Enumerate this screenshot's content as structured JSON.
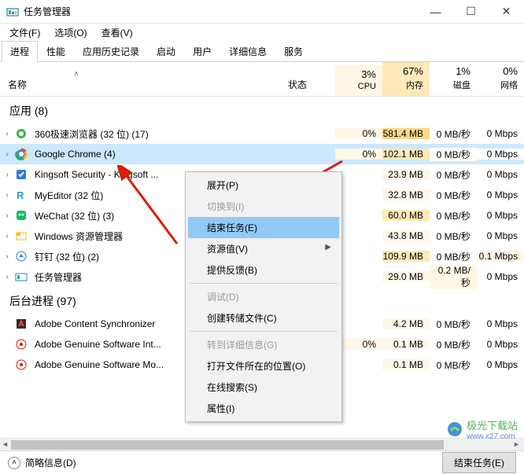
{
  "window": {
    "title": "任务管理器"
  },
  "window_controls": {
    "min": "—",
    "max": "☐",
    "close": "✕"
  },
  "menu": {
    "file": "文件(F)",
    "options": "选项(O)",
    "view": "查看(V)"
  },
  "tabs": [
    "进程",
    "性能",
    "应用历史记录",
    "启动",
    "用户",
    "详细信息",
    "服务"
  ],
  "columns": {
    "name": "名称",
    "status": "状态",
    "cpu": {
      "pct": "3%",
      "label": "CPU"
    },
    "mem": {
      "pct": "67%",
      "label": "内存"
    },
    "disk": {
      "pct": "1%",
      "label": "磁盘"
    },
    "net": {
      "pct": "0%",
      "label": "网络"
    }
  },
  "sort_indicator": "˄",
  "groups": {
    "apps": "应用 (8)",
    "background": "后台进程 (97)"
  },
  "rows": [
    {
      "name": "360极速浏览器 (32 位) (17)",
      "cpu": "0%",
      "mem": "581.4 MB",
      "disk": "0 MB/秒",
      "net": "0 Mbps",
      "memClass": "hot1"
    },
    {
      "name": "Google Chrome (4)",
      "cpu": "0%",
      "mem": "102.1 MB",
      "disk": "0 MB/秒",
      "net": "0 Mbps",
      "selected": true,
      "memClass": "hot2"
    },
    {
      "name": "Kingsoft Security - Kingsoft ...",
      "cpu": "",
      "mem": "23.9 MB",
      "disk": "0 MB/秒",
      "net": "0 Mbps"
    },
    {
      "name": "MyEditor (32 位)",
      "cpu": "",
      "mem": "32.8 MB",
      "disk": "0 MB/秒",
      "net": "0 Mbps"
    },
    {
      "name": "WeChat (32 位) (3)",
      "cpu": "",
      "mem": "60.0 MB",
      "disk": "0 MB/秒",
      "net": "0 Mbps",
      "memClass": "hot2"
    },
    {
      "name": "Windows 资源管理器",
      "cpu": "",
      "mem": "43.8 MB",
      "disk": "0 MB/秒",
      "net": "0 Mbps"
    },
    {
      "name": "钉钉 (32 位) (2)",
      "cpu": "",
      "mem": "109.9 MB",
      "disk": "0 MB/秒",
      "net": "0.1 Mbps",
      "memClass": "hot2",
      "netClass": "hot"
    },
    {
      "name": "任务管理器",
      "cpu": "",
      "mem": "29.0 MB",
      "disk": "0.2 MB/秒",
      "net": "0 Mbps",
      "diskClass": "hot"
    }
  ],
  "bg_rows": [
    {
      "name": "Adobe Content Synchronizer",
      "cpu": "",
      "mem": "4.2 MB",
      "disk": "0 MB/秒",
      "net": "0 Mbps"
    },
    {
      "name": "Adobe Genuine Software Int...",
      "cpu": "0%",
      "mem": "0.1 MB",
      "disk": "0 MB/秒",
      "net": "0 Mbps"
    },
    {
      "name": "Adobe Genuine Software Mo...",
      "cpu": "",
      "mem": "0.1 MB",
      "disk": "0 MB/秒",
      "net": "0 Mbps"
    }
  ],
  "context_menu": {
    "expand": "展开(P)",
    "switch_to": "切换到(I)",
    "end_task": "结束任务(E)",
    "resource_values": "资源值(V)",
    "feedback": "提供反馈(B)",
    "debug": "调试(D)",
    "create_dump": "创建转储文件(C)",
    "go_details": "转到详细信息(G)",
    "open_location": "打开文件所在的位置(O)",
    "search_online": "在线搜索(S)",
    "properties": "属性(I)"
  },
  "statusbar": {
    "fewer": "简略信息(D)",
    "end_task": "结束任务(E)"
  },
  "watermark": {
    "name": "极光下载站",
    "url": "www.x27.com"
  }
}
